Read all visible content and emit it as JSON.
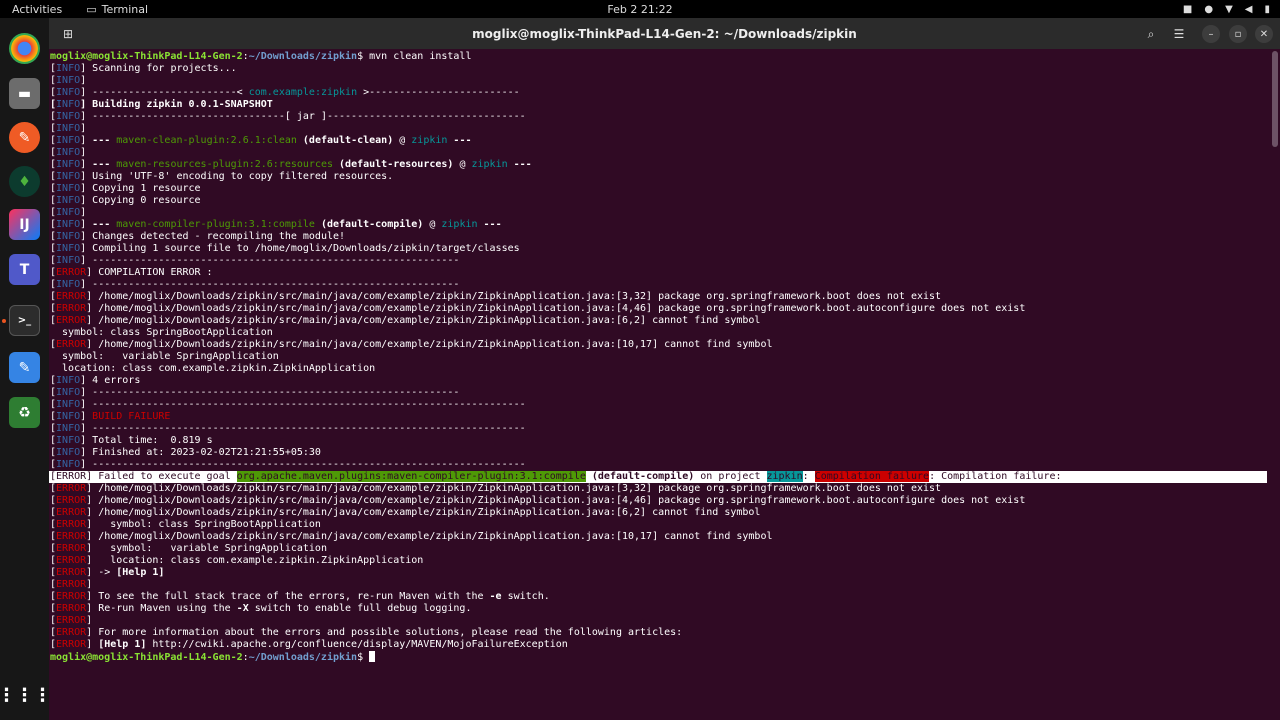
{
  "topbar": {
    "activities": "Activities",
    "app_name": "Terminal",
    "clock": "Feb 2  21:22"
  },
  "dock": {
    "items": [
      "chrome-icon",
      "files-icon",
      "postman-icon",
      "mongodb-compass-icon",
      "intellij-icon",
      "teams-icon",
      "terminal-icon",
      "text-editor-icon",
      "trash-icon",
      "show-apps-icon"
    ]
  },
  "window": {
    "title": "moglix@moglix-ThinkPad-L14-Gen-2: ~/Downloads/zipkin"
  },
  "terminal": {
    "prompt_user": "moglix@moglix-ThinkPad-L14-Gen-2",
    "prompt_path": "~/Downloads/zipkin",
    "command": " mvn clean install",
    "info_tag": "INFO",
    "error_tag": "ERROR",
    "lines": {
      "l1": " Scanning for projects...",
      "l3a": " ------------------------< ",
      "l3b": "com.example:zipkin",
      "l3c": " >-------------------------",
      "l4": " Building zipkin 0.0.1-SNAPSHOT",
      "l5": " --------------------------------[ jar ]---------------------------------",
      "l7a": " --- ",
      "l7b": "maven-clean-plugin:2.6.1:clean",
      "l7c": " (default-clean)",
      "l7d": " @ ",
      "l7e": "zipkin",
      "l7f": " ---",
      "l9b": "maven-resources-plugin:2.6:resources",
      "l9c": " (default-resources)",
      "l10": " Using 'UTF-8' encoding to copy filtered resources.",
      "l11": " Copying 1 resource",
      "l12": " Copying 0 resource",
      "l14b": "maven-compiler-plugin:3.1:compile",
      "l14c": " (default-compile)",
      "l15": " Changes detected - recompiling the module!",
      "l16": " Compiling 1 source file to /home/moglix/Downloads/zipkin/target/classes",
      "l17": " -------------------------------------------------------------",
      "l18": " COMPILATION ERROR : ",
      "l20": " /home/moglix/Downloads/zipkin/src/main/java/com/example/zipkin/ZipkinApplication.java:[3,32] package org.springframework.boot does not exist",
      "l21": " /home/moglix/Downloads/zipkin/src/main/java/com/example/zipkin/ZipkinApplication.java:[4,46] package org.springframework.boot.autoconfigure does not exist",
      "l22": " /home/moglix/Downloads/zipkin/src/main/java/com/example/zipkin/ZipkinApplication.java:[6,2] cannot find symbol",
      "l23": "  symbol: class SpringBootApplication",
      "l24": " /home/moglix/Downloads/zipkin/src/main/java/com/example/zipkin/ZipkinApplication.java:[10,17] cannot find symbol",
      "l25": "  symbol:   variable SpringApplication",
      "l26": "  location: class com.example.zipkin.ZipkinApplication",
      "l27": " 4 errors",
      "l29": " ------------------------------------------------------------------------",
      "l30": " BUILD FAILURE",
      "l32": " Total time:  0.819 s",
      "l33": " Finished at: 2023-02-02T21:21:55+05:30",
      "l35a": " Failed to execute goal ",
      "l35b": "org.apache.maven.plugins:maven-compiler-plugin:3.1:compile",
      "l35c": " (default-compile)",
      "l35d": " on project ",
      "l35e": "zipkin",
      "l35f": ": ",
      "l35g": "Compilation failure",
      "l35h": ": Compilation failure:",
      "l39": "   symbol: class SpringBootApplication",
      "l41": "   symbol:   variable SpringApplication",
      "l42": "   location: class com.example.zipkin.ZipkinApplication",
      "l43a": " -> ",
      "l43b": "[Help 1]",
      "l45a": " To see the full stack trace of the errors, re-run Maven with the ",
      "l45b": "-e",
      "l45c": " switch.",
      "l46a": " Re-run Maven using the ",
      "l46b": "-X",
      "l46c": " switch to enable full debug logging.",
      "l48": " For more information about the errors and possible solutions, please read the following articles:",
      "l49a": " [Help 1]",
      "l49b": " http://cwiki.apache.org/confluence/display/MAVEN/MojoFailureException"
    }
  }
}
